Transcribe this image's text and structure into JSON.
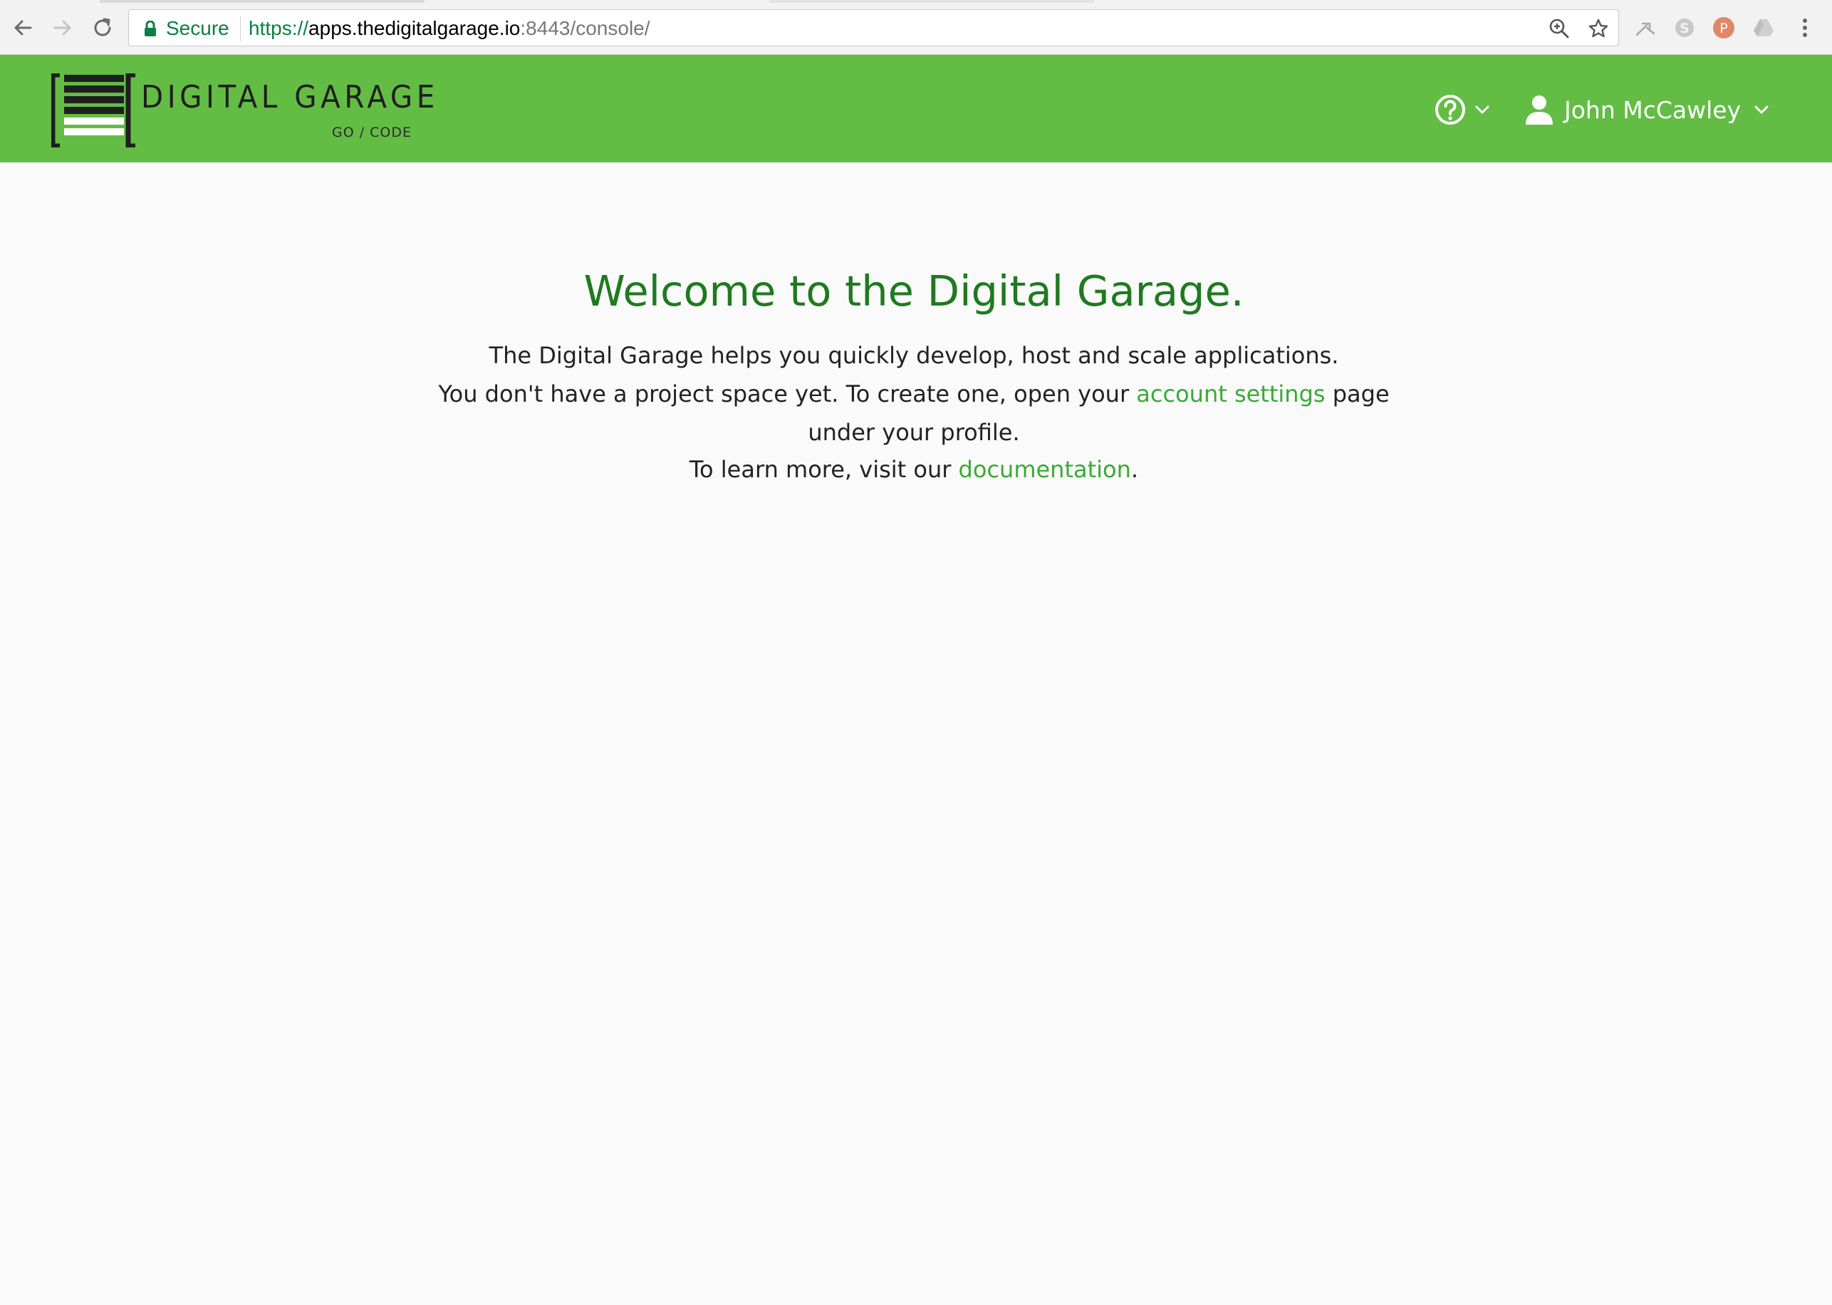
{
  "browser": {
    "secure_label": "Secure",
    "url": {
      "scheme": "https://",
      "host": "apps.thedigitalgarage.io",
      "rest": ":8443/console/"
    }
  },
  "header": {
    "logo": {
      "wordmark": "DIGITAL GARAGE",
      "tagline": "GO / CODE"
    },
    "help_icon": "question-circle-icon",
    "user": {
      "name": "John McCawley"
    }
  },
  "main": {
    "title": "Welcome to the Digital Garage.",
    "line1": "The Digital Garage helps you quickly develop, host and scale applications.",
    "line2_before": "You don't have a project space yet. To create one, open your ",
    "line2_link": "account settings",
    "line2_after": " page under your profile.",
    "learn_before": "To learn more, visit our ",
    "learn_link": "documentation",
    "learn_after": "."
  },
  "colors": {
    "header_green": "#63bd45",
    "title_green": "#1f7a1f",
    "link_green": "#3aaa35",
    "secure_green": "#0b8043"
  }
}
